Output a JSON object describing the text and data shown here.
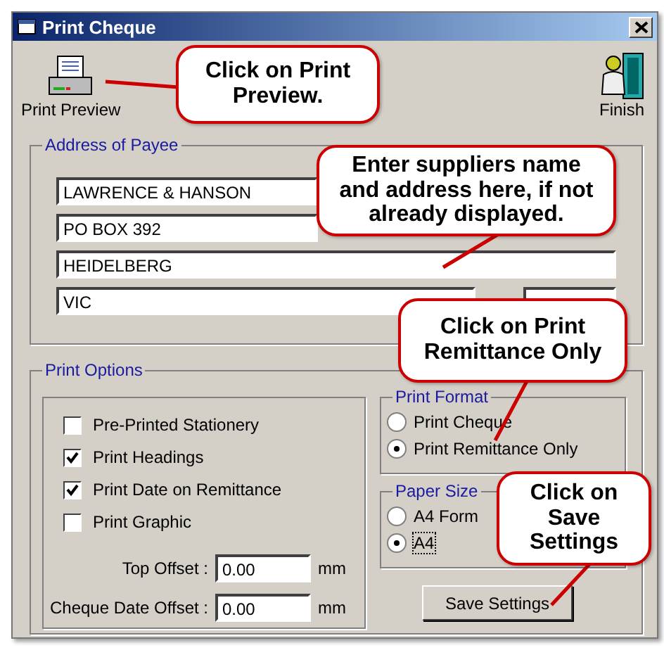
{
  "window": {
    "title": "Print Cheque"
  },
  "toolbar": [
    {
      "label": "Print Preview",
      "kind": "printer"
    },
    {
      "label": "Finish",
      "kind": "exit"
    }
  ],
  "address": {
    "title": "Address of Payee",
    "lines": [
      "LAWRENCE & HANSON",
      "PO BOX 392",
      "HEIDELBERG"
    ],
    "state": "VIC"
  },
  "print_options": {
    "title": "Print Options",
    "checkboxes": [
      {
        "label": "Pre-Printed Stationery",
        "checked": false
      },
      {
        "label": "Print Headings",
        "checked": true
      },
      {
        "label": "Print Date on Remittance",
        "checked": true
      },
      {
        "label": "Print Graphic",
        "checked": false
      }
    ],
    "offsets": [
      {
        "label": "Top Offset :",
        "value": "0.00",
        "unit": "mm"
      },
      {
        "label": "Cheque Date Offset :",
        "value": "0.00",
        "unit": "mm"
      }
    ]
  },
  "print_format": {
    "title": "Print Format",
    "options": [
      {
        "label": "Print Cheque",
        "selected": false
      },
      {
        "label": "Print Remittance Only",
        "selected": true
      }
    ]
  },
  "paper_size": {
    "title": "Paper Size",
    "options": [
      {
        "label": "A4 Form",
        "selected": false
      },
      {
        "label": "A4",
        "selected": true
      }
    ]
  },
  "save_button": {
    "label": "Save Settings"
  },
  "callouts": [
    {
      "text": "Click on Print Preview."
    },
    {
      "text": "Enter suppliers name and address here, if not already displayed."
    },
    {
      "text": "Click on Print Remittance Only"
    },
    {
      "text": "Click on Save Settings"
    }
  ]
}
